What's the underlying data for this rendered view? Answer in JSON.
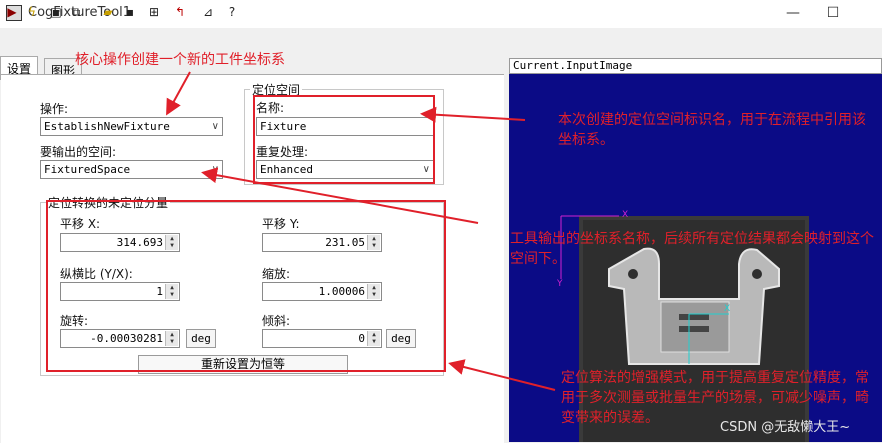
{
  "window": {
    "title": "CogFixtureTool1",
    "minimize": "—",
    "maximize": "☐"
  },
  "toolbar": {
    "icons": [
      "run-icon",
      "lightning-icon",
      "display-icon",
      "subrecord-icon",
      "open-icon",
      "save-icon",
      "import-icon",
      "reset-icon",
      "calibrate-icon",
      "help-icon"
    ]
  },
  "tabs": [
    {
      "label": "设置"
    },
    {
      "label": "图形"
    }
  ],
  "settings": {
    "operation_label": "操作:",
    "operation_value": "EstablishNewFixture",
    "output_space_label": "要输出的空间:",
    "output_space_value": "FixturedSpace",
    "fixture_group_title": "定位空间",
    "name_label": "名称:",
    "name_value": "Fixture",
    "repeat_label": "重复处理:",
    "repeat_value": "Enhanced",
    "transform_group_title": "定位转换的未定位分量",
    "translate_x_label": "平移 X:",
    "translate_x_value": "314.693",
    "translate_y_label": "平移 Y:",
    "translate_y_value": "231.05",
    "aspect_label": "纵横比 (Y/X):",
    "aspect_value": "1",
    "scale_label": "缩放:",
    "scale_value": "1.00006",
    "rotation_label": "旋转:",
    "rotation_value": "-0.00030281",
    "rotation_unit": "deg",
    "skew_label": "倾斜:",
    "skew_value": "0",
    "skew_unit": "deg",
    "reset_button": "重新设置为恒等"
  },
  "image_panel": {
    "title": "Current.InputImage"
  },
  "annotations": {
    "a1": "核心操作创建一个新的工件坐标系",
    "a2": "本次创建的定位空间标识名，用于在流程中引用该坐标系。",
    "a3": "工具输出的坐标系名称，后续所有定位结果都会映射到这个空间下。",
    "a4": "定位算法的增强模式，用于提高重复定位精度，常用于多次测量或批量生产的场景，可减少噪声，畸变带来的误差。"
  },
  "watermark": "CSDN @无敌懒大王~",
  "colors": {
    "annotation_red": "#e0202a",
    "image_bg": "#0b0b86"
  }
}
